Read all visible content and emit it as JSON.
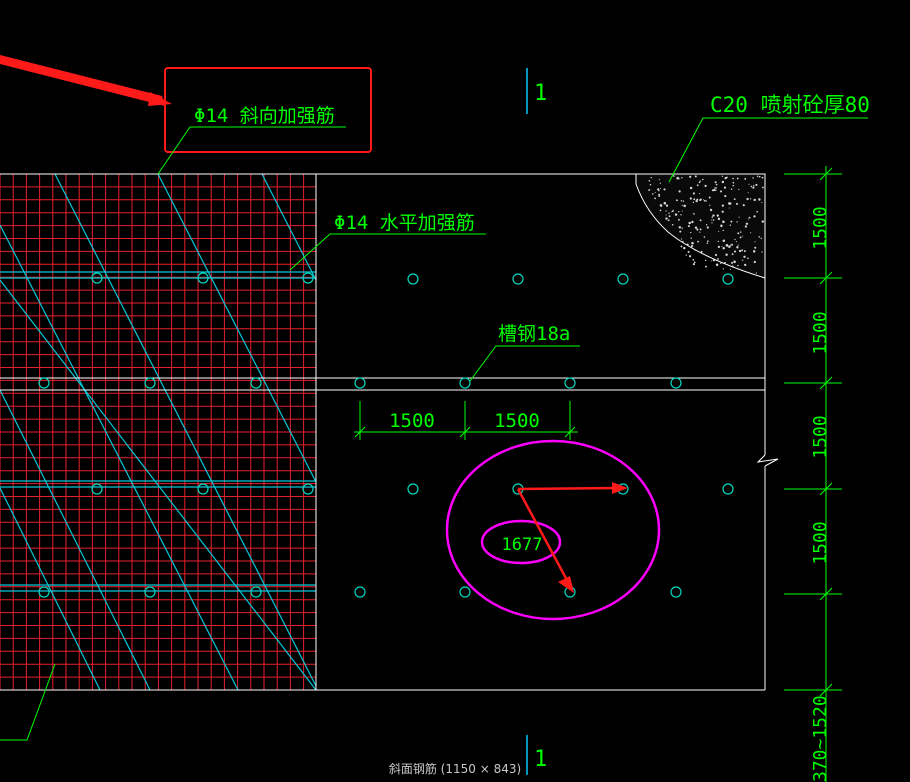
{
  "labels": {
    "diagonal_rebar": "Φ14 斜向加强筋",
    "horizontal_rebar": "Φ14 水平加强筋",
    "shotcrete": "C20 喷射砼厚80",
    "channel_steel": "槽钢18a",
    "section_mark": "1",
    "measured_value": "1677"
  },
  "dimensions": {
    "horizontal": [
      "1500",
      "1500"
    ],
    "vertical": [
      "1500",
      "1500",
      "1500",
      "1500"
    ],
    "bottom_range": "370~1520"
  },
  "caption": "斜面钢筋 (1150 × 843)",
  "colors": {
    "mesh": "#e8202c",
    "rebar": "#00c8d8",
    "text": "#00ff00",
    "outline": "#ffffff",
    "highlight": "#ff1a1a",
    "annotation": "#ff00ff",
    "bolt": "#00d8c0"
  }
}
